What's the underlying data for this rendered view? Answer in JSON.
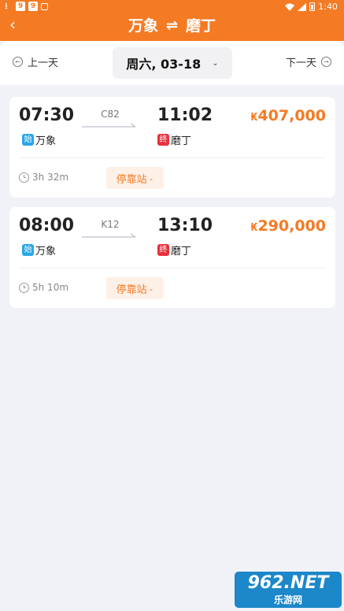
{
  "status_bar": {
    "time": "1:40",
    "icons": [
      "download-icon",
      "app-icon",
      "app-icon",
      "app-icon"
    ]
  },
  "header": {
    "from": "万象",
    "swap_glyph": "⇌",
    "to": "磨丁"
  },
  "date_nav": {
    "prev_label": "上一天",
    "date_label": "周六, 03-18",
    "next_label": "下一天"
  },
  "trains": [
    {
      "dep_time": "07:30",
      "train_no": "C82",
      "arr_time": "11:02",
      "currency": "₭",
      "price": "407,000",
      "start_tag": "始",
      "dep_station": "万象",
      "end_tag": "终",
      "arr_station": "磨丁",
      "duration": "3h 32m",
      "stops_label": "停靠站"
    },
    {
      "dep_time": "08:00",
      "train_no": "K12",
      "arr_time": "13:10",
      "currency": "₭",
      "price": "290,000",
      "start_tag": "始",
      "dep_station": "万象",
      "end_tag": "终",
      "arr_station": "磨丁",
      "duration": "5h 10m",
      "stops_label": "停靠站"
    }
  ],
  "watermark": {
    "top": "962.NET",
    "bottom": "乐游网"
  },
  "colors": {
    "accent": "#f57a24",
    "start_tag": "#2aa6e8",
    "end_tag": "#e8303a",
    "background": "#f0f2f7"
  }
}
